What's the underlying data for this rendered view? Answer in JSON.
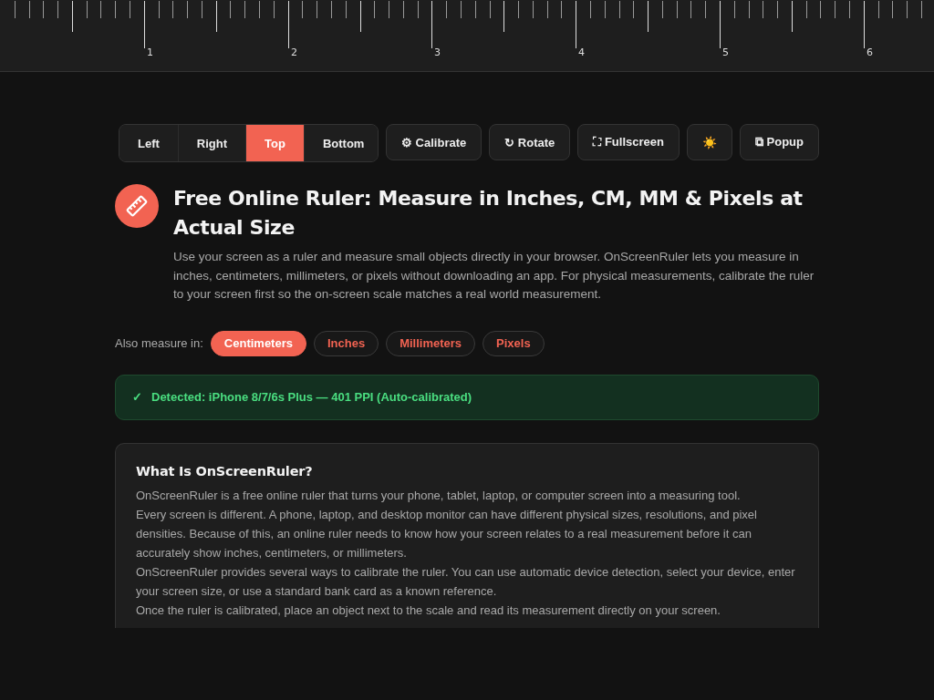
{
  "ruler": {
    "labels": [
      "1",
      "2",
      "3",
      "4",
      "5",
      "6"
    ]
  },
  "toolbar": {
    "sides": [
      {
        "label": "Left",
        "selected": false
      },
      {
        "label": "Right",
        "selected": false
      },
      {
        "label": "Top",
        "selected": true
      },
      {
        "label": "Bottom",
        "selected": false
      }
    ],
    "buttons": [
      "⚙ Calibrate",
      "↻ Rotate",
      "⛶ Fullscreen",
      "☀️",
      "⧉ Popup"
    ]
  },
  "header": {
    "title": "Free Online Ruler: Measure in Inches, CM, MM & Pixels at Actual Size",
    "description": "Use your screen as a ruler and measure small objects directly in your browser. OnScreenRuler lets you measure in inches, centimeters, millimeters, or pixels without downloading an app. For physical measurements, calibrate the ruler to your screen first so the on-screen scale matches a real world measurement."
  },
  "units": {
    "label": "Also measure in:",
    "items": [
      {
        "label": "Centimeters",
        "selected": true
      },
      {
        "label": "Inches",
        "selected": false
      },
      {
        "label": "Millimeters",
        "selected": false
      },
      {
        "label": "Pixels",
        "selected": false
      }
    ]
  },
  "detected": {
    "icon": "✓",
    "text": "Detected: iPhone 8/7/6s Plus — 401 PPI (Auto-calibrated)"
  },
  "info": {
    "heading": "What Is OnScreenRuler?",
    "paragraphs": [
      "OnScreenRuler is a free online ruler that turns your phone, tablet, laptop, or computer screen into a measuring tool.",
      "Every screen is different. A phone, laptop, and desktop monitor can have different physical sizes, resolutions, and pixel densities. Because of this, an online ruler needs to know how your screen relates to a real measurement before it can accurately show inches, centimeters, or millimeters.",
      "OnScreenRuler provides several ways to calibrate the ruler. You can use automatic device detection, select your device, enter your screen size, or use a standard bank card as a known reference.",
      "Once the ruler is calibrated, place an object next to the scale and read its measurement directly on your screen."
    ]
  }
}
